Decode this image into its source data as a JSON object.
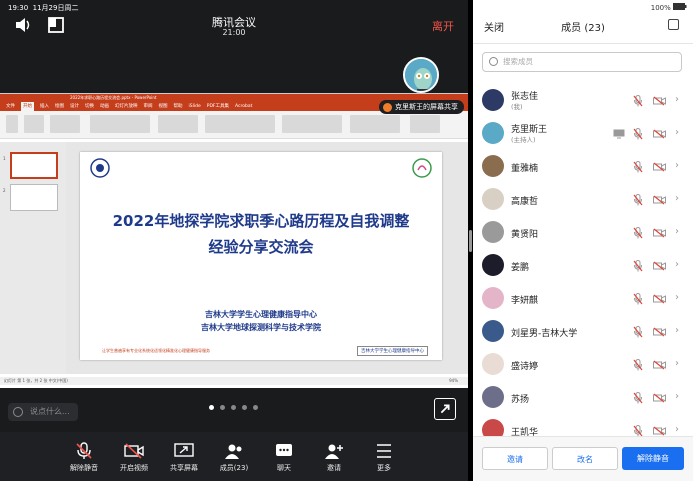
{
  "status": {
    "time": "19:30",
    "date": "11月29日周二",
    "battery": "100%"
  },
  "meeting": {
    "title": "腾讯会议",
    "duration": "21:00",
    "leave_label": "离开"
  },
  "share_badge": "克里斯王的屏幕共享",
  "ppt": {
    "window_title": "2022年求职心路历程交流会.pptx - PowerPoint",
    "tabs": [
      "文件",
      "开始",
      "插入",
      "绘图",
      "设计",
      "切换",
      "动画",
      "幻灯片放映",
      "审阅",
      "视图",
      "帮助",
      "iSlide",
      "PDF工具集",
      "Acrobat"
    ],
    "status_text": "幻灯片 第 1 张，共 2 张   中文(中国)",
    "zoom": "94%",
    "thumb_numbers": [
      "1",
      "2"
    ]
  },
  "slide": {
    "line1": "2022年地探学院求职季心路历程及自我调整",
    "line2": "经验分享交流会",
    "org1": "吉林大学学生心理健康指导中心",
    "org2": "吉林大学地球探测科学与技术学院",
    "footer_left": "让学生普遍享有专业化系统化适领化精准化心理健康指导服务",
    "footer_right": "吉林大学学生心理健康指导中心"
  },
  "chat": {
    "placeholder": "说点什么..."
  },
  "toolbar": {
    "items": [
      {
        "label": "解除静音",
        "icon": "mic-muted-icon"
      },
      {
        "label": "开启视频",
        "icon": "camera-off-icon"
      },
      {
        "label": "共享屏幕",
        "icon": "share-screen-icon"
      },
      {
        "label": "成员(23)",
        "icon": "members-icon"
      },
      {
        "label": "聊天",
        "icon": "chat-icon"
      },
      {
        "label": "邀请",
        "icon": "invite-icon"
      },
      {
        "label": "更多",
        "icon": "more-icon"
      }
    ]
  },
  "panel": {
    "close_label": "关闭",
    "title": "成员 (23)",
    "search_placeholder": "搜索成员",
    "members": [
      {
        "name": "张志佳",
        "role": "(我)",
        "color": "#2d3a66"
      },
      {
        "name": "克里斯王",
        "role": "(主持人)",
        "color": "#5aa9c6"
      },
      {
        "name": "董雅楠",
        "role": "",
        "color": "#8a6d4f"
      },
      {
        "name": "高康哲",
        "role": "",
        "color": "#d8d0c4"
      },
      {
        "name": "黄贤阳",
        "role": "",
        "color": "#9a9a9a"
      },
      {
        "name": "姜鹏",
        "role": "",
        "color": "#1c1c2a"
      },
      {
        "name": "李妍麒",
        "role": "",
        "color": "#e4b5c8"
      },
      {
        "name": "刘星男-吉林大学",
        "role": "",
        "color": "#3b5a8c"
      },
      {
        "name": "盛诗婷",
        "role": "",
        "color": "#e8dcd5"
      },
      {
        "name": "苏扬",
        "role": "",
        "color": "#6d6f8a"
      },
      {
        "name": "王凯华",
        "role": "",
        "color": "#c94848"
      }
    ],
    "buttons": {
      "invite": "邀请",
      "rename": "改名",
      "unmute_all": "解除静音"
    }
  }
}
